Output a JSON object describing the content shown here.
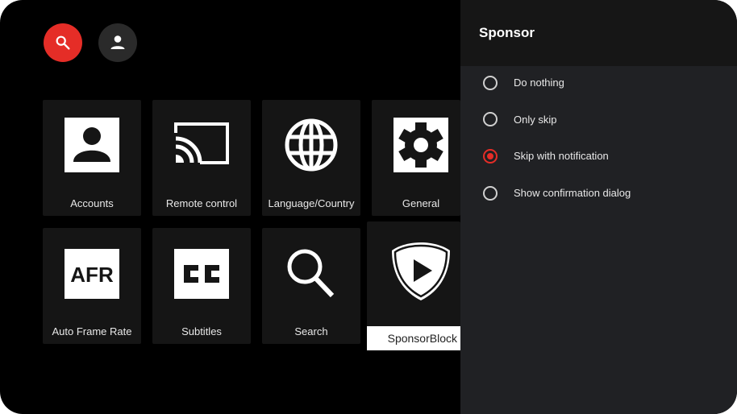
{
  "top_bar": {
    "search_button": {
      "icon": "search-icon",
      "color": "#e52d27"
    },
    "account_button": {
      "icon": "person-icon"
    }
  },
  "settings_grid": {
    "tiles": [
      {
        "label": "Accounts",
        "icon": "account-box-icon"
      },
      {
        "label": "Remote control",
        "icon": "cast-icon"
      },
      {
        "label": "Language/Country",
        "icon": "globe-icon"
      },
      {
        "label": "General",
        "icon": "settings-gear-icon"
      },
      {
        "label": "Auto Frame Rate",
        "icon": "afr-icon",
        "icon_text": "AFR"
      },
      {
        "label": "Subtitles",
        "icon": "closed-caption-icon"
      },
      {
        "label": "Search",
        "icon": "search-icon"
      },
      {
        "label": "SponsorBlock",
        "icon": "sponsorblock-shield-icon",
        "focused": true
      }
    ]
  },
  "panel": {
    "title": "Sponsor",
    "options": [
      {
        "label": "Do nothing",
        "selected": false
      },
      {
        "label": "Only skip",
        "selected": false
      },
      {
        "label": "Skip with notification",
        "selected": true
      },
      {
        "label": "Show confirmation dialog",
        "selected": false
      }
    ],
    "accent_color": "#e52d27"
  }
}
